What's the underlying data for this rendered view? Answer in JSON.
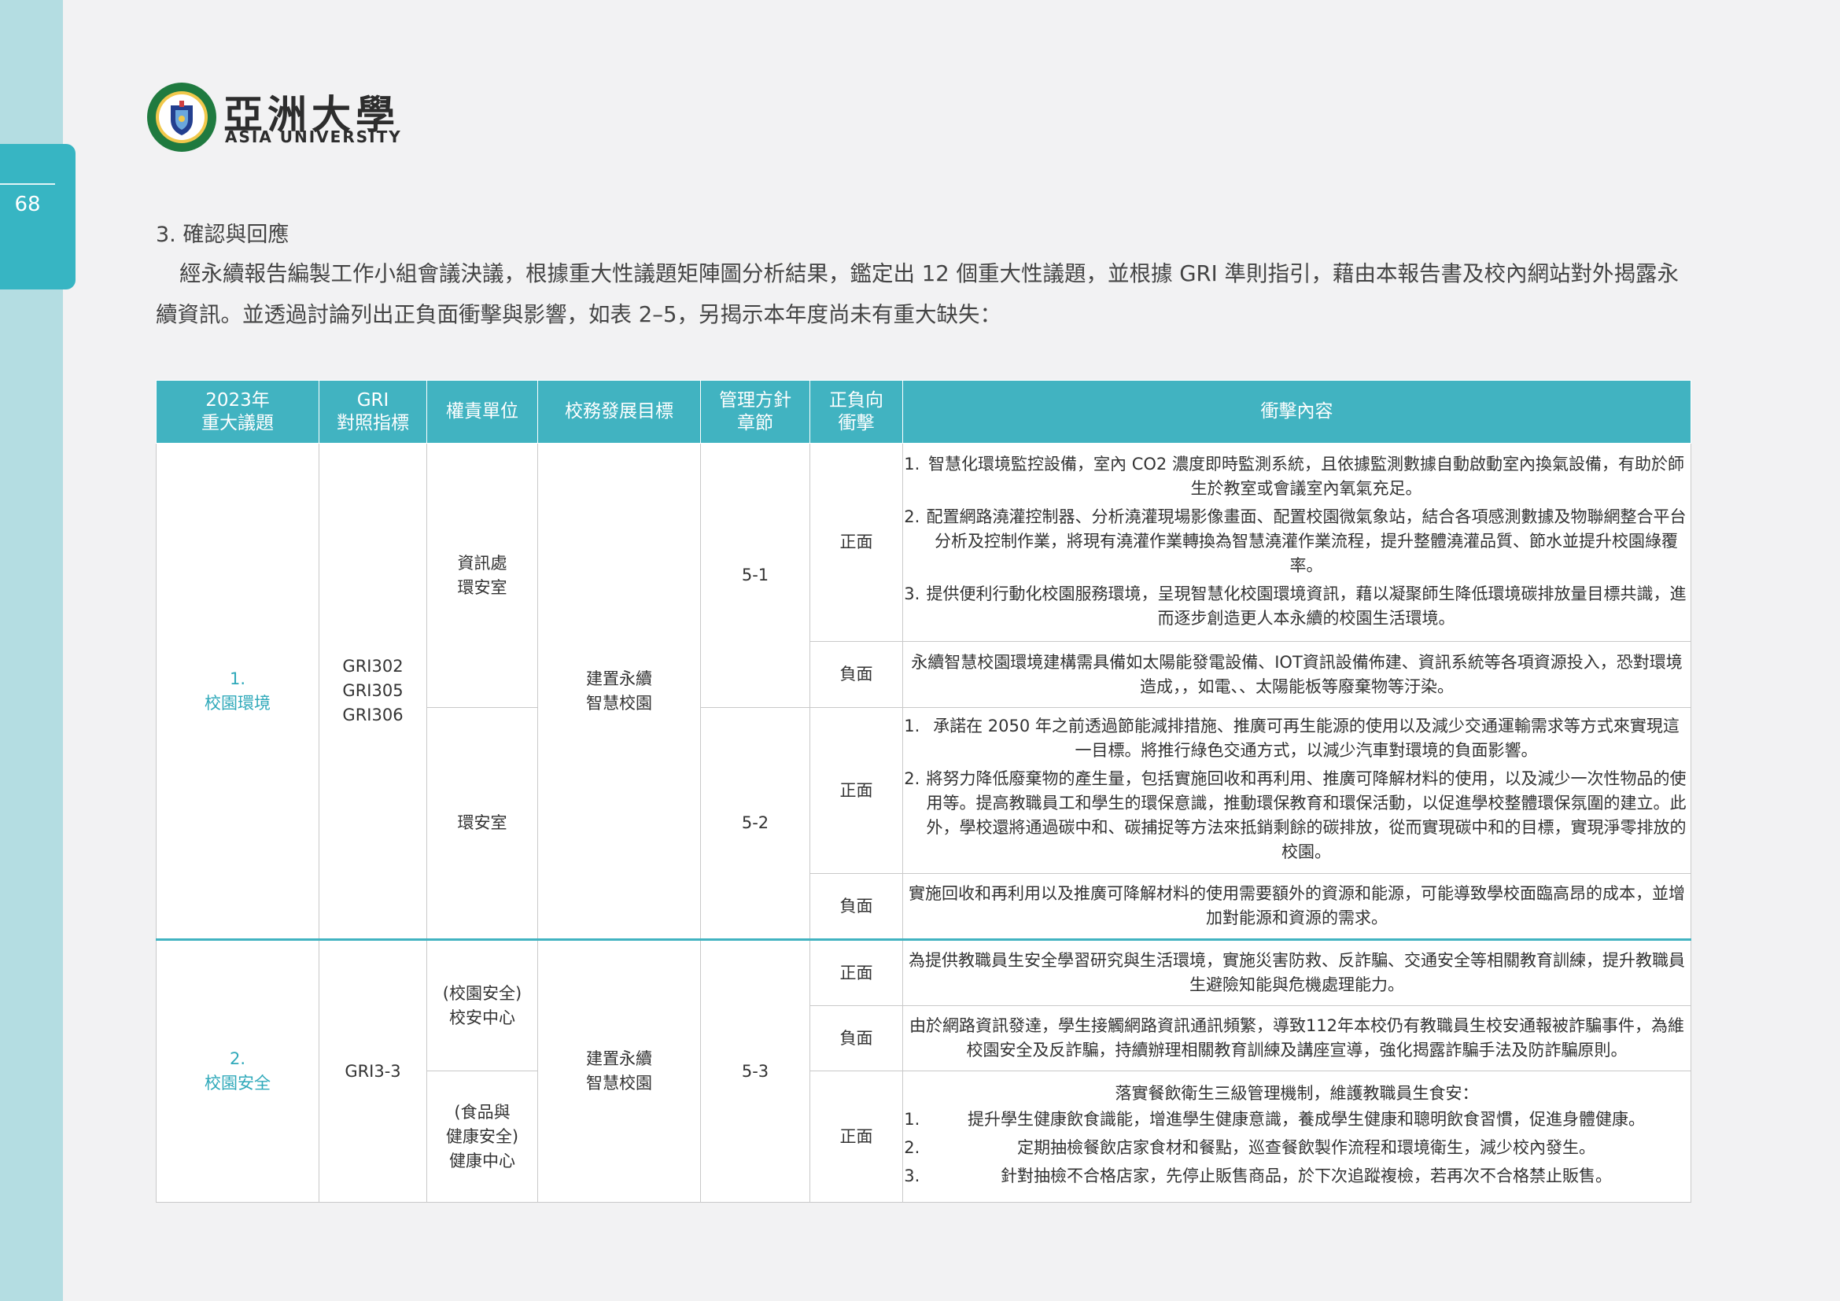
{
  "page": {
    "number": "68"
  },
  "logo": {
    "name_zh": "亞洲大學",
    "name_en": "ASIA UNIVERSITY",
    "seal_text": "ASIA UNIVERSITY"
  },
  "section": {
    "heading": "3. 確認與回應",
    "paragraph": "經永續報告編製工作小組會議決議，根據重大性議題矩陣圖分析結果，鑑定出 12 個重大性議題，並根據 GRI 準則指引，藉由本報告書及校內網站對外揭露永續資訊。並透過討論列出正負面衝擊與影響，如表 2–5，另揭示本年度尚未有重大缺失："
  },
  "table": {
    "headers": {
      "topic_line1": "2023年",
      "topic_line2": "重大議題",
      "gri_line1": "GRI",
      "gri_line2": "對照指標",
      "unit": "權責單位",
      "goal": "校務發展目標",
      "chapter_line1": "管理方針",
      "chapter_line2": "章節",
      "impact_line1": "正負向",
      "impact_line2": "衝擊",
      "content": "衝擊內容"
    },
    "topics": [
      {
        "num": "1.",
        "name": "校園環境",
        "gri": [
          "GRI302",
          "GRI305",
          "GRI306"
        ],
        "goal_line1": "建置永續",
        "goal_line2": "智慧校園",
        "units": [
          {
            "lines": [
              "資訊處",
              "環安室"
            ],
            "chapter": "5-1",
            "positive_label": "正面",
            "positive_items": [
              "智慧化環境監控設備，室內 CO2 濃度即時監測系統，且依據監測數據自動啟動室內換氣設備，有助於師生於教室或會議室內氧氣充足。",
              "配置網路澆灌控制器、分析澆灌現場影像畫面、配置校園微氣象站，結合各項感測數據及物聯網整合平台分析及控制作業，將現有澆灌作業轉換為智慧澆灌作業流程，提升整體澆灌品質、節水並提升校園綠覆率。",
              "提供便利行動化校園服務環境，呈現智慧化校園環境資訊，藉以凝聚師生降低環境碳排放量目標共識，進而逐步創造更人本永續的校園生活環境。"
            ],
            "negative_label": "負面",
            "negative_text": "永續智慧校園環境建構需具備如太陽能發電設備、IOT資訊設備佈建、資訊系統等各項資源投入，恐對環境造成，，如電、、太陽能板等廢棄物等汙染。"
          },
          {
            "lines": [
              "環安室"
            ],
            "chapter": "5-2",
            "positive_label": "正面",
            "positive_items": [
              "承諾在 2050 年之前透過節能減排措施、推廣可再生能源的使用以及減少交通運輸需求等方式來實現這一目標。將推行綠色交通方式，以減少汽車對環境的負面影響。",
              "將努力降低廢棄物的產生量，包括實施回收和再利用、推廣可降解材料的使用，以及減少一次性物品的使用等。提高教職員工和學生的環保意識，推動環保教育和環保活動，以促進學校整體環保氛圍的建立。此外，學校還將通過碳中和、碳捕捉等方法來抵銷剩餘的碳排放，從而實現碳中和的目標，實現淨零排放的校園。"
            ],
            "negative_label": "負面",
            "negative_text": "實施回收和再利用以及推廣可降解材料的使用需要額外的資源和能源，可能導致學校面臨高昂的成本，並增加對能源和資源的需求。"
          }
        ]
      },
      {
        "num": "2.",
        "name": "校園安全",
        "gri": [
          "GRI3-3"
        ],
        "goal_line1": "建置永續",
        "goal_line2": "智慧校園",
        "chapter": "5-3",
        "units": [
          {
            "lines": [
              "(校園安全)",
              "校安中心"
            ],
            "positive_label": "正面",
            "positive_text": "為提供教職員生安全學習研究與生活環境，實施災害防救、反詐騙、交通安全等相關教育訓練，提升教職員生避險知能與危機處理能力。",
            "negative_label": "負面",
            "negative_text": "由於網路資訊發達，學生接觸網路資訊通訊頻繁，導致112年本校仍有教職員生校安通報被詐騙事件，為維校園安全及反詐騙，持續辦理相關教育訓練及講座宣導，強化揭露詐騙手法及防詐騙原則。"
          },
          {
            "lines": [
              "(食品與",
              "健康安全)",
              "健康中心"
            ],
            "positive_label": "正面",
            "positive_intro": "落實餐飲衛生三級管理機制，維護教職員生食安：",
            "positive_items": [
              "提升學生健康飲食識能，增進學生健康意識，養成學生健康和聰明飲食習慣，促進身體健康。",
              "定期抽檢餐飲店家食材和餐點，巡查餐飲製作流程和環境衛生，減少校內發生。",
              "針對抽檢不合格店家，先停止販售商品，於下次追蹤複檢，若再次不合格禁止販售。"
            ]
          }
        ]
      }
    ]
  }
}
